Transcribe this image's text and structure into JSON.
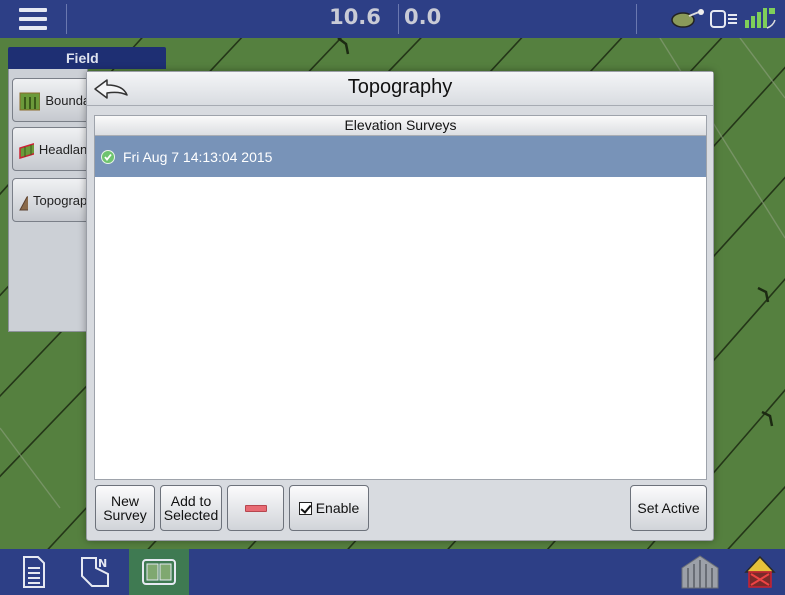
{
  "topbar": {
    "speed": "10.6",
    "heading": "0.0",
    "icons": [
      "menu-icon",
      "connection-icon",
      "display-icon",
      "gps-signal-icon"
    ]
  },
  "field_panel": {
    "tab_label": "Field",
    "buttons": [
      {
        "label": "Boundary",
        "icon": "boundary-icon"
      },
      {
        "label": "Headlands",
        "icon": "headland-icon"
      },
      {
        "label": "Topography",
        "icon": "topography-icon"
      }
    ]
  },
  "dialog": {
    "title": "Topography",
    "list": {
      "header": "Elevation Surveys",
      "rows": [
        {
          "label": "Fri Aug 7 14:13:04 2015",
          "status": "active-check-icon",
          "selected": true
        }
      ]
    },
    "buttons": {
      "new_survey": "New Survey",
      "add_to_selected": "Add to Selected",
      "enable": "Enable",
      "enable_checked": true,
      "set_active": "Set Active"
    }
  },
  "bottombar": {
    "icons": [
      "document-icon",
      "field-map-icon",
      "split-view-icon",
      "implement-icon",
      "warning-icon"
    ]
  },
  "colors": {
    "bar_blue": "#2d3f86",
    "field_green": "#55803f",
    "selected_row": "#7893b8",
    "remove_red": "#e86a73"
  }
}
